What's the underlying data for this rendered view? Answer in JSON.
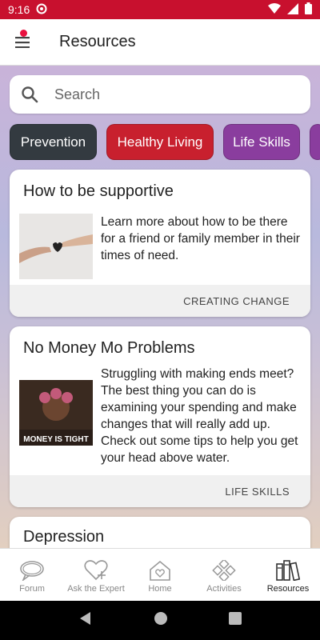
{
  "status_bar": {
    "time": "9:16",
    "bg_color": "#c8102e"
  },
  "app_bar": {
    "title": "Resources"
  },
  "search": {
    "placeholder": "Search"
  },
  "chips": [
    {
      "label": "Prevention",
      "color": "#333a40"
    },
    {
      "label": "Healthy Living",
      "color": "#c8202e"
    },
    {
      "label": "Life Skills",
      "color": "#8a3d9e"
    }
  ],
  "cards": [
    {
      "title": "How to be supportive",
      "description": "Learn more about how to be there for a friend or family member in their times of need.",
      "category": "CREATING CHANGE",
      "image_icon": "hands-heart-image"
    },
    {
      "title": "No Money Mo Problems",
      "description": "Struggling with making ends meet? The best thing you can do is examining your spending and make changes that will really add up. Check out some tips to help you get your head above water.",
      "category": "LIFE SKILLS",
      "image_caption": "MONEY IS TIGHT"
    },
    {
      "title": "Depression"
    }
  ],
  "bottom_nav": [
    {
      "label": "Forum",
      "icon": "chat-bubble-icon"
    },
    {
      "label": "Ask the Expert",
      "icon": "heart-plus-icon"
    },
    {
      "label": "Home",
      "icon": "home-heart-icon"
    },
    {
      "label": "Activities",
      "icon": "gamepad-icon"
    },
    {
      "label": "Resources",
      "icon": "books-icon",
      "active": true
    }
  ]
}
